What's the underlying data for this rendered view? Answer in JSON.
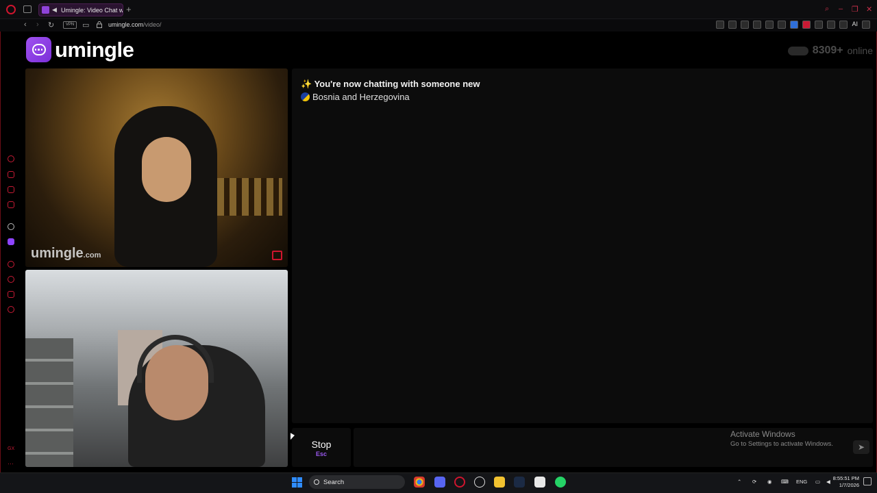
{
  "browser": {
    "tab_title": "Umingle: Video Chat w",
    "new_tab_symbol": "+",
    "url_host": "umingle.com",
    "url_path": "/video/",
    "vpn_label": "VPN",
    "extensions_label": "AI"
  },
  "site": {
    "logo_text": "umingle",
    "online_count": "8309+",
    "online_label": "online"
  },
  "video": {
    "watermark_main": "umingle",
    "watermark_suffix": ".com"
  },
  "chat": {
    "status_icon": "✨",
    "status_message": "You're now chatting with someone new",
    "country": "Bosnia and Herzegovina"
  },
  "controls": {
    "stop_label": "Stop",
    "stop_shortcut": "Esc",
    "message_placeholder": "",
    "send_icon": "send-icon"
  },
  "windows_notice": {
    "title": "Activate Windows",
    "subtitle": "Go to Settings to activate Windows."
  },
  "taskbar": {
    "search_label": "Search",
    "language": "ENG",
    "time": "8:55:51 PM",
    "date": "1/7/2026"
  },
  "colors": {
    "brand_purple": "#8f43d9",
    "opera_red": "#d0152e",
    "chat_bg": "#0c0c0c"
  }
}
